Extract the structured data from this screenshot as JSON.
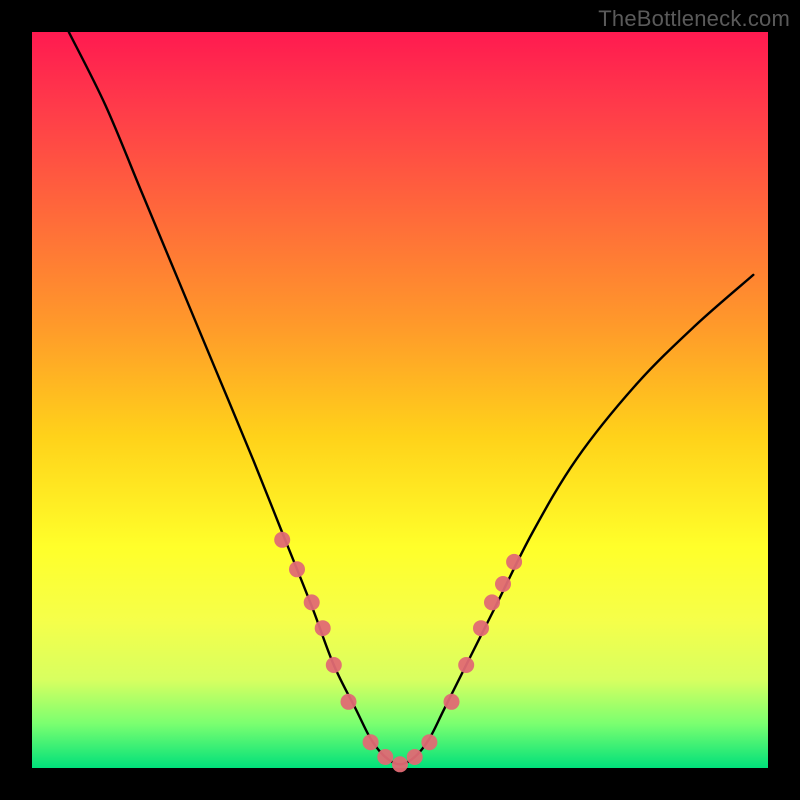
{
  "watermark": "TheBottleneck.com",
  "chart_data": {
    "type": "line",
    "title": "",
    "xlabel": "",
    "ylabel": "",
    "xlim": [
      0,
      100
    ],
    "ylim": [
      0,
      100
    ],
    "grid": false,
    "legend": false,
    "series": [
      {
        "name": "curve",
        "x": [
          5,
          10,
          15,
          20,
          25,
          30,
          34,
          38,
          41,
          44,
          46,
          48,
          50,
          52,
          54,
          56,
          59,
          63,
          68,
          74,
          82,
          90,
          98
        ],
        "y": [
          100,
          90,
          78,
          66,
          54,
          42,
          32,
          22,
          14,
          8,
          4,
          1.5,
          0.5,
          1.5,
          4,
          8,
          14,
          22,
          32,
          42,
          52,
          60,
          67
        ]
      }
    ],
    "markers": {
      "name": "highlighted-points",
      "x": [
        34,
        36,
        38,
        39.5,
        41,
        43,
        46,
        48,
        50,
        52,
        54,
        57,
        59,
        61,
        62.5,
        64,
        65.5
      ],
      "y": [
        31,
        27,
        22.5,
        19,
        14,
        9,
        3.5,
        1.5,
        0.5,
        1.5,
        3.5,
        9,
        14,
        19,
        22.5,
        25,
        28
      ]
    },
    "background_gradient": {
      "top": "#ff1a50",
      "mid": "#ffff2a",
      "bottom": "#00e07a"
    }
  }
}
